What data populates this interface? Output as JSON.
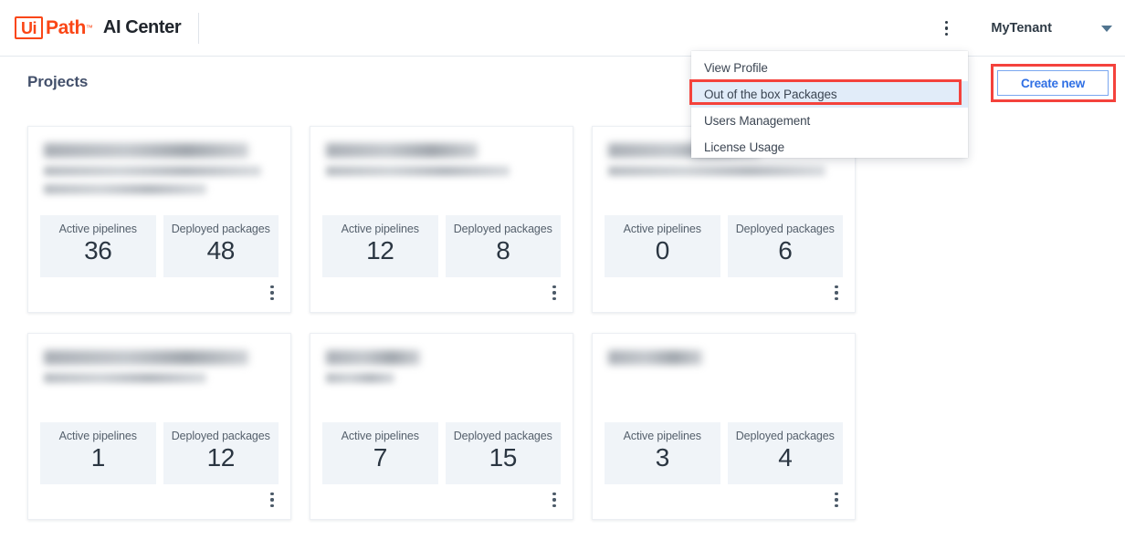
{
  "header": {
    "logo_mark": "Ui",
    "logo_word": "Path",
    "logo_tm": "™",
    "app_name": "AI Center",
    "kebab_icon": "more-vertical-icon",
    "tenant": "MyTenant",
    "caret_icon": "chevron-down-icon"
  },
  "page": {
    "title": "Projects",
    "create_new_label": "Create new"
  },
  "dropdown": {
    "items": [
      {
        "label": "View Profile",
        "selected": false
      },
      {
        "label": "Out of the box Packages",
        "selected": true
      },
      {
        "label": "Users Management",
        "selected": false
      },
      {
        "label": "License Usage",
        "selected": false
      }
    ]
  },
  "stat_labels": {
    "active_pipelines": "Active pipelines",
    "deployed_packages": "Deployed packages"
  },
  "cards": [
    {
      "active_pipelines": "36",
      "deployed_packages": "48",
      "kebab_icon": "more-vertical-icon"
    },
    {
      "active_pipelines": "12",
      "deployed_packages": "8",
      "kebab_icon": "more-vertical-icon"
    },
    {
      "active_pipelines": "0",
      "deployed_packages": "6",
      "kebab_icon": "more-vertical-icon"
    },
    {
      "active_pipelines": "1",
      "deployed_packages": "12",
      "kebab_icon": "more-vertical-icon"
    },
    {
      "active_pipelines": "7",
      "deployed_packages": "15",
      "kebab_icon": "more-vertical-icon"
    },
    {
      "active_pipelines": "3",
      "deployed_packages": "4",
      "kebab_icon": "more-vertical-icon"
    }
  ],
  "colors": {
    "brand_orange": "#fa4616",
    "accent_blue": "#2f6fe4",
    "highlight_red": "#f4423c",
    "menu_selected_bg": "#e1ecf9",
    "stat_bg": "#f0f4f8",
    "title_color": "#43506b"
  }
}
